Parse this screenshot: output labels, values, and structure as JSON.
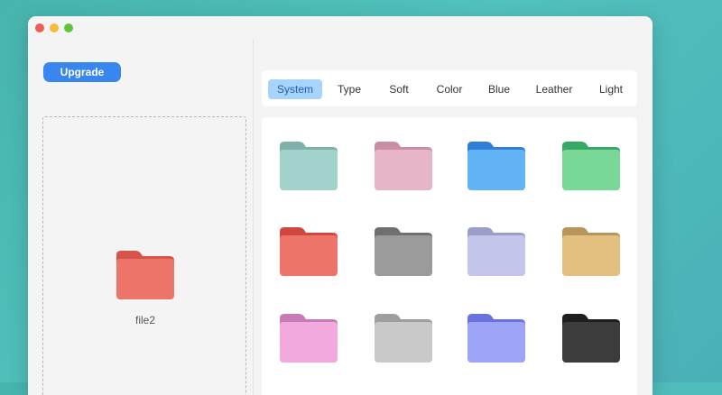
{
  "sidebar": {
    "upgrade_label": "Upgrade",
    "drop_file": {
      "name": "file2",
      "back": "#d8544a",
      "front": "#ec7468",
      "icon": "folder-icon"
    }
  },
  "tabs": [
    {
      "label": "System",
      "active": true
    },
    {
      "label": "Type",
      "active": false
    },
    {
      "label": "Soft",
      "active": false
    },
    {
      "label": "Color",
      "active": false
    },
    {
      "label": "Blue",
      "active": false
    },
    {
      "label": "Leather",
      "active": false
    },
    {
      "label": "Light",
      "active": false
    }
  ],
  "folders": [
    {
      "name": "teal",
      "back": "#7fb0aa",
      "front": "#a2d3cc"
    },
    {
      "name": "pink",
      "back": "#c98ea6",
      "front": "#e8b4c8"
    },
    {
      "name": "blue",
      "back": "#2f7ed8",
      "front": "#63b4f7"
    },
    {
      "name": "green",
      "back": "#38a866",
      "front": "#79d898"
    },
    {
      "name": "red",
      "back": "#d0473f",
      "front": "#ec7468"
    },
    {
      "name": "gray",
      "back": "#6f6f6f",
      "front": "#9b9b9b"
    },
    {
      "name": "lavender",
      "back": "#9b9ec8",
      "front": "#c3c5ea"
    },
    {
      "name": "tan",
      "back": "#b8965a",
      "front": "#e3c080"
    },
    {
      "name": "magenta",
      "back": "#c77bb7",
      "front": "#f2a9de"
    },
    {
      "name": "silver",
      "back": "#9f9f9f",
      "front": "#c9c9c9"
    },
    {
      "name": "periwinkle",
      "back": "#6a72e0",
      "front": "#9ea4f6"
    },
    {
      "name": "black",
      "back": "#1e1e1e",
      "front": "#3c3c3c"
    }
  ]
}
